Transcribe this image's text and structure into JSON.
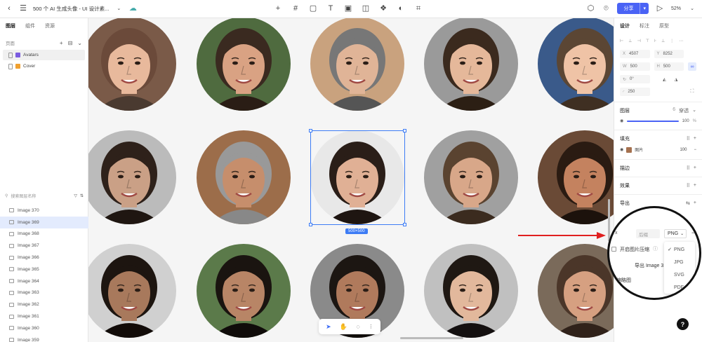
{
  "topbar": {
    "doc_title": "500 个 AI 生成头像 - UI 设计素...",
    "share_label": "分享",
    "zoom": "52%"
  },
  "left": {
    "tabs": [
      "图层",
      "组件",
      "资源"
    ],
    "pages_header": "页面",
    "pages": [
      {
        "label": "Avatars",
        "color": "#7b5ce0"
      },
      {
        "label": "Cover",
        "color": "#f0a030"
      }
    ],
    "search_placeholder": "搜索图层名称",
    "layers": [
      "Image 370",
      "Image 369",
      "Image 368",
      "Image 367",
      "Image 366",
      "Image 365",
      "Image 364",
      "Image 363",
      "Image 362",
      "Image 361",
      "Image 360",
      "Image 359"
    ],
    "active_layer_index": 1
  },
  "canvas": {
    "selection_size": "500×500"
  },
  "right": {
    "tabs": [
      "设计",
      "标注",
      "原型"
    ],
    "props": {
      "x": "4507",
      "y": "8252",
      "w": "500",
      "h": "500",
      "rotation": "0°",
      "radius": "250"
    },
    "layer_section": "图层",
    "layer_blend": "穿透",
    "layer_count": "6",
    "opacity": "100",
    "fill_section": "填充",
    "fill_type": "图片",
    "fill_opacity": "100",
    "stroke_section": "描边",
    "effect_section": "效果",
    "export_section": "导出"
  },
  "export_popup": {
    "scale_placeholder": "后缀",
    "format": "PNG",
    "compress_label": "开启图片压缩",
    "export_button": "导出 Image 3",
    "thumbnail_label": "缩略图",
    "format_options": [
      "PNG",
      "JPG",
      "SVG",
      "PDF"
    ],
    "selected_format": "PNG"
  }
}
